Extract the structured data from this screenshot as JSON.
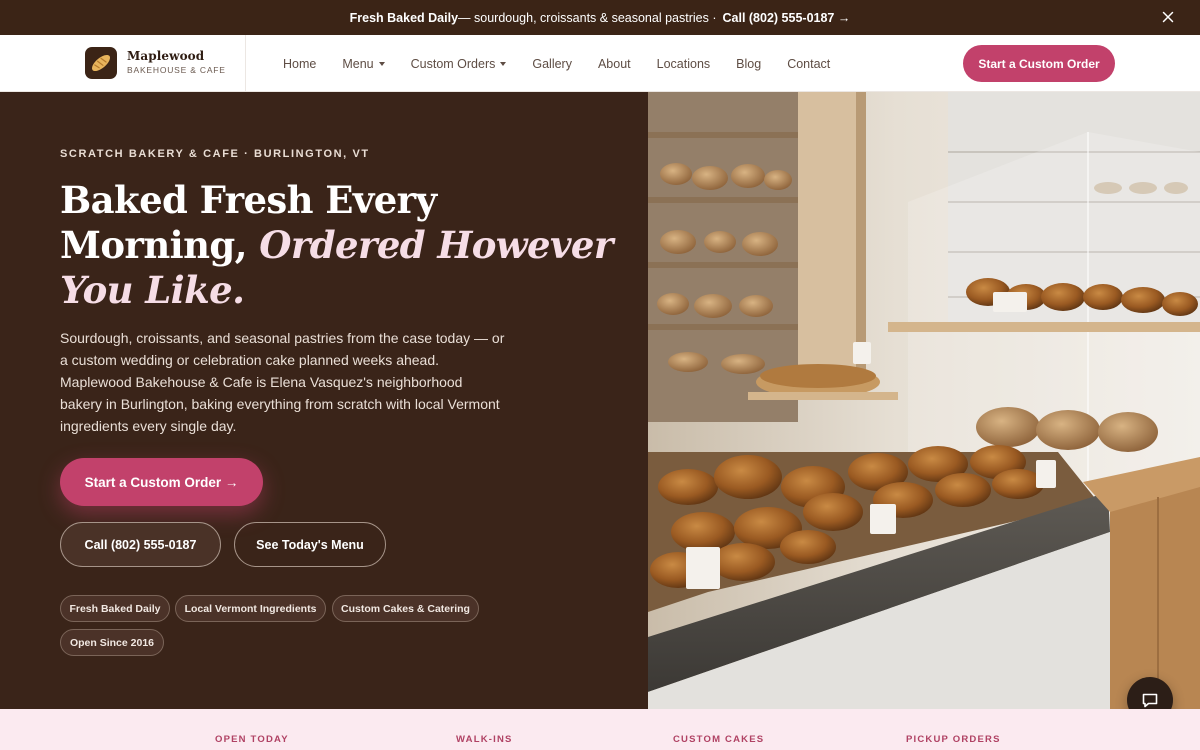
{
  "announcement": {
    "bold": "Fresh Baked Daily",
    "text": " — sourdough, croissants & seasonal pastries ·",
    "phone": "Call (802) 555-0187 →"
  },
  "brand": {
    "name": "Maplewood",
    "sub": "BAKEHOUSE & CAFE"
  },
  "nav": {
    "items": [
      {
        "label": "Home"
      },
      {
        "label": "Menu"
      },
      {
        "label": "Custom Orders"
      },
      {
        "label": "Gallery"
      },
      {
        "label": "About"
      },
      {
        "label": "Locations"
      },
      {
        "label": "Blog"
      },
      {
        "label": "Contact"
      }
    ],
    "cta": "Start a Custom Order"
  },
  "hero": {
    "eyebrow": "SCRATCH BAKERY & CAFE · BURLINGTON, VT",
    "headline_line1": "Baked Fresh Every",
    "headline_line2a": "Morning, ",
    "headline_line2b": "Ordered However",
    "headline_line3": " You Like.",
    "lead": "Sourdough, croissants, and seasonal pastries from the case today — or a custom wedding or celebration cake planned weeks ahead. Maplewood Bakehouse & Cafe is Elena Vasquez's neighborhood bakery in Burlington, baking everything from scratch with local Vermont ingredients every single day.",
    "primary_cta": "Start a Custom Order →",
    "call_cta": "Call (802) 555-0187",
    "menu_cta": "See Today's Menu",
    "chips": [
      "Fresh Baked Daily",
      "Local Vermont Ingredients",
      "Custom Cakes & Catering",
      "Open Since 2016"
    ]
  },
  "info_strip": {
    "labels": [
      "OPEN TODAY",
      "WALK-INS",
      "CUSTOM CAKES",
      "PICKUP ORDERS"
    ]
  },
  "colors": {
    "accent": "#c2416b",
    "dark_brown": "#3a2419",
    "announce_bg": "#3b2416",
    "strip_bg": "#fbeaf0"
  },
  "icons": {
    "close": "close-icon",
    "logo": "bread-icon",
    "chat": "chat-bubble-icon"
  }
}
